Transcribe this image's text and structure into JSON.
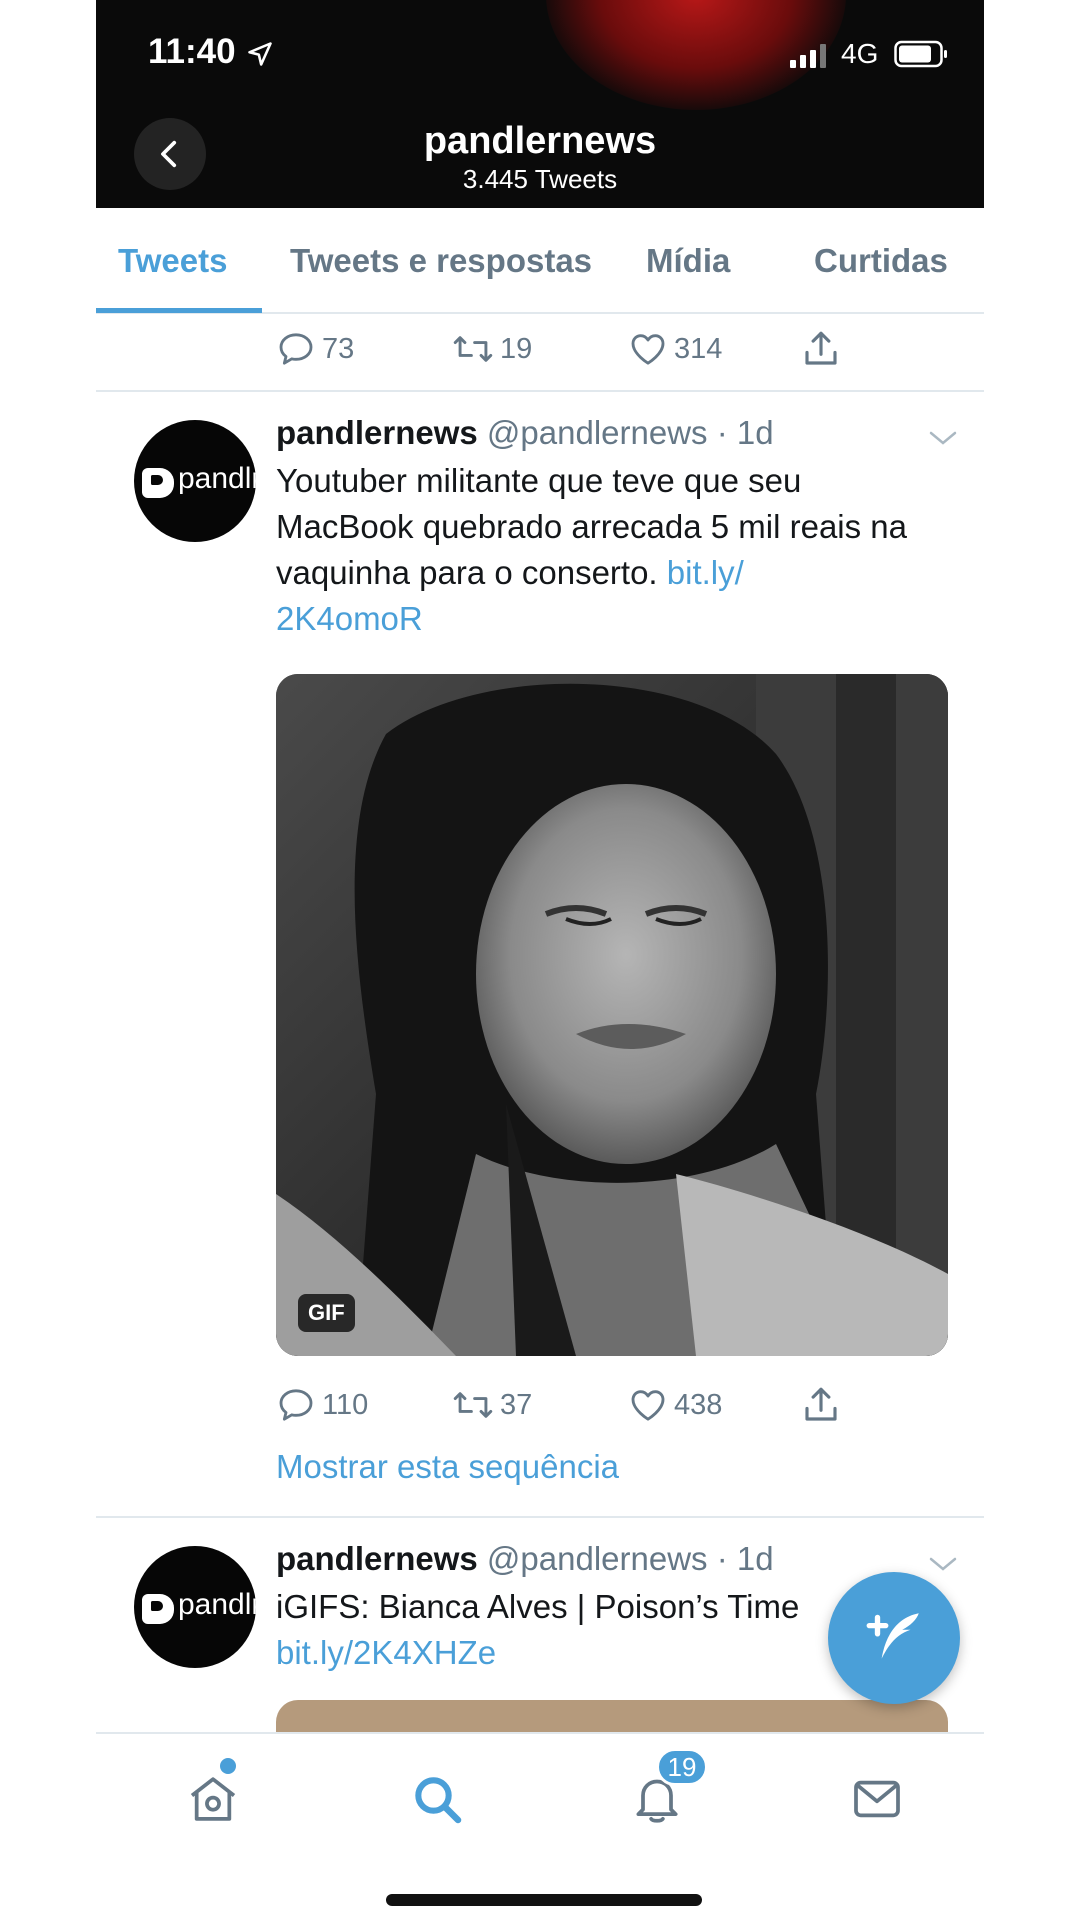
{
  "status_bar": {
    "time": "11:40",
    "network": "4G"
  },
  "header": {
    "profile_name": "pandlernews",
    "tweet_count": "3.445 Tweets"
  },
  "tabs": [
    {
      "label": "Tweets",
      "active": true
    },
    {
      "label": "Tweets e respostas",
      "active": false
    },
    {
      "label": "Mídia",
      "active": false
    },
    {
      "label": "Curtidas",
      "active": false
    }
  ],
  "previous_tweet_actions": {
    "replies": "73",
    "retweets": "19",
    "likes": "314"
  },
  "tweets": [
    {
      "avatar_text": "pandlr",
      "author": "pandlernews",
      "handle": "@pandlernews",
      "time": "· 1d",
      "text": "Youtuber militante que teve que seu MacBook quebrado arrecada 5 mil reais na vaquinha para o conserto. ",
      "link": "bit.ly/\n2K4omoR",
      "media_badge": "GIF",
      "replies": "110",
      "retweets": "37",
      "likes": "438",
      "show_thread": "Mostrar esta sequência"
    },
    {
      "avatar_text": "pandlr",
      "author": "pandlernews",
      "handle": "@pandlernews",
      "time": "· 1d",
      "text": "iGIFS: Bianca Alves | Poison’s Time",
      "link": "bit.ly/2K4XHZe"
    }
  ],
  "bottom_nav": {
    "notifications_badge": "19"
  },
  "icons": {
    "back": "chevron-left-icon",
    "location": "location-arrow-icon",
    "signal": "signal-icon",
    "battery": "battery-icon",
    "reply": "reply-icon",
    "retweet": "retweet-icon",
    "like": "heart-icon",
    "share": "share-icon",
    "compose": "compose-tweet-icon",
    "home": "home-icon",
    "search": "search-icon",
    "notifications": "bell-icon",
    "messages": "mail-icon"
  },
  "colors": {
    "accent": "#4a9fd8",
    "text": "#14171a",
    "secondary": "#657786",
    "header_bg": "#0a0a0a"
  }
}
